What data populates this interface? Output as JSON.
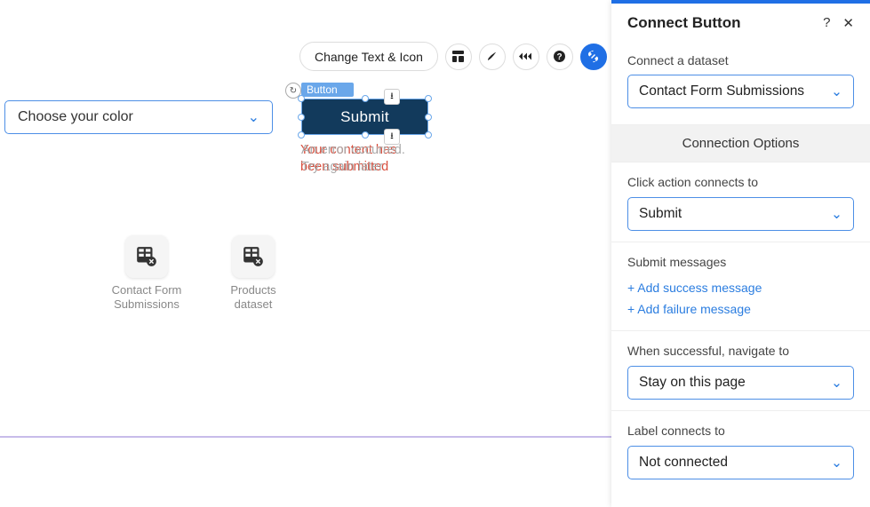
{
  "canvas": {
    "color_dropdown": {
      "placeholder": "Choose your color"
    },
    "toolbar": {
      "change_text": "Change Text & Icon"
    },
    "selected": {
      "element_type": "Button",
      "button_label": "Submit"
    },
    "messages": {
      "line1_fail": "Your content has",
      "line2_fail": "been submitted",
      "line1_gray_overlay": "An error occurred.",
      "line2_gray_overlay": "Try again later"
    },
    "datasets": [
      {
        "label": "Contact Form Submissions"
      },
      {
        "label": "Products dataset"
      }
    ]
  },
  "panel": {
    "title": "Connect Button",
    "connect_dataset": {
      "label": "Connect a dataset",
      "value": "Contact Form Submissions"
    },
    "options_header": "Connection Options",
    "click_action": {
      "label": "Click action connects to",
      "value": "Submit"
    },
    "submit_messages": {
      "label": "Submit messages",
      "add_success": "+ Add success message",
      "add_failure": "+ Add failure message"
    },
    "navigate": {
      "label": "When successful, navigate to",
      "value": "Stay on this page"
    },
    "label_connects": {
      "label": "Label connects to",
      "value": "Not connected"
    }
  }
}
